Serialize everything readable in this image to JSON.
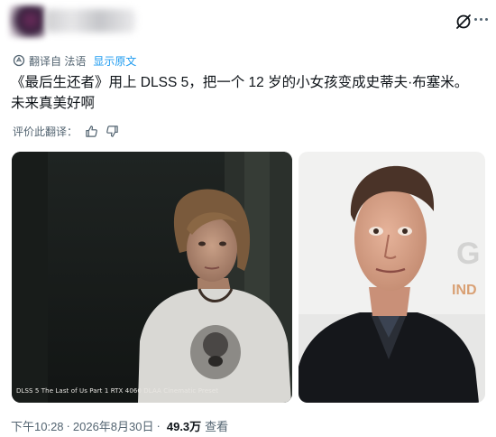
{
  "translate": {
    "label": "翻译自 法语",
    "show_original": "显示原文"
  },
  "tweet": {
    "line1": "《最后生还者》用上 DLSS 5，把一个 12 岁的小女孩变成史蒂夫·布塞米。",
    "line2": "未来真美好啊"
  },
  "rate": {
    "label": "评价此翻译："
  },
  "media": {
    "left_caption": "DLSS 5 The Last of Us Part 1 RTX 4060 DLAA Cinematic Preset"
  },
  "footer": {
    "time": "下午10:28",
    "separator": "·",
    "date": "2026年8月30日",
    "views": "49.3万",
    "views_label": "查看"
  },
  "colors": {
    "text": "#0f1419",
    "muted": "#536471",
    "link": "#1d9bf0"
  }
}
